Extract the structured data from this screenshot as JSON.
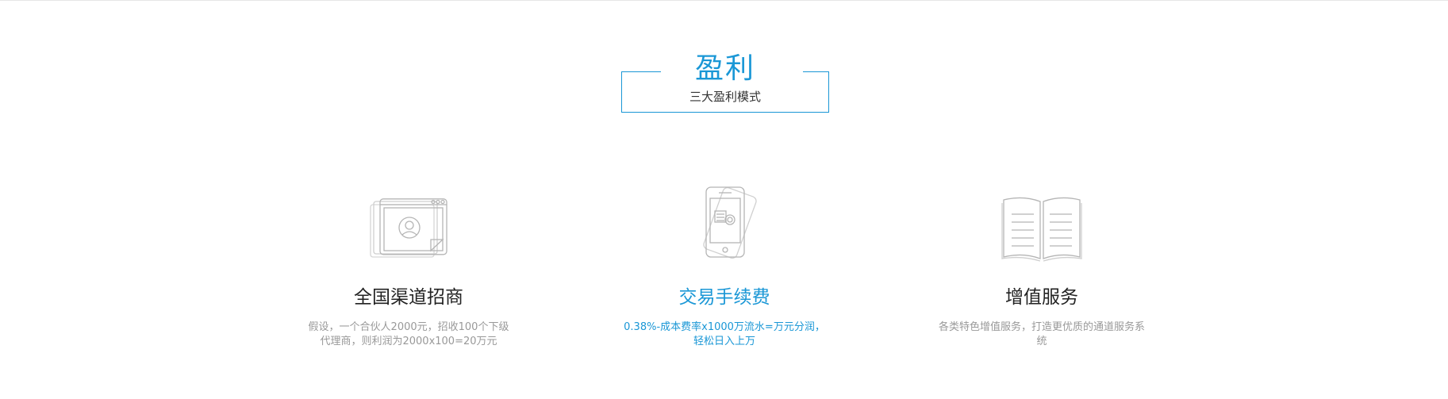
{
  "section": {
    "title": "盈利",
    "subtitle": "三大盈利模式"
  },
  "features": [
    {
      "icon": "agent-window-icon",
      "title": "全国渠道招商",
      "desc": "假设，一个合伙人2000元，招收100个下级代理商，则利润为2000x100=20万元"
    },
    {
      "icon": "mobile-payment-icon",
      "title": "交易手续费",
      "desc": "0.38%-成本费率x1000万流水=万元分润，轻松日入上万"
    },
    {
      "icon": "open-book-icon",
      "title": "增值服务",
      "desc": "各类特色增值服务，打造更优质的通道服务系统"
    }
  ],
  "colors": {
    "accent": "#1a97d6",
    "title": "#222222",
    "muted": "#999999",
    "icon_stroke": "#b5b5b5"
  }
}
